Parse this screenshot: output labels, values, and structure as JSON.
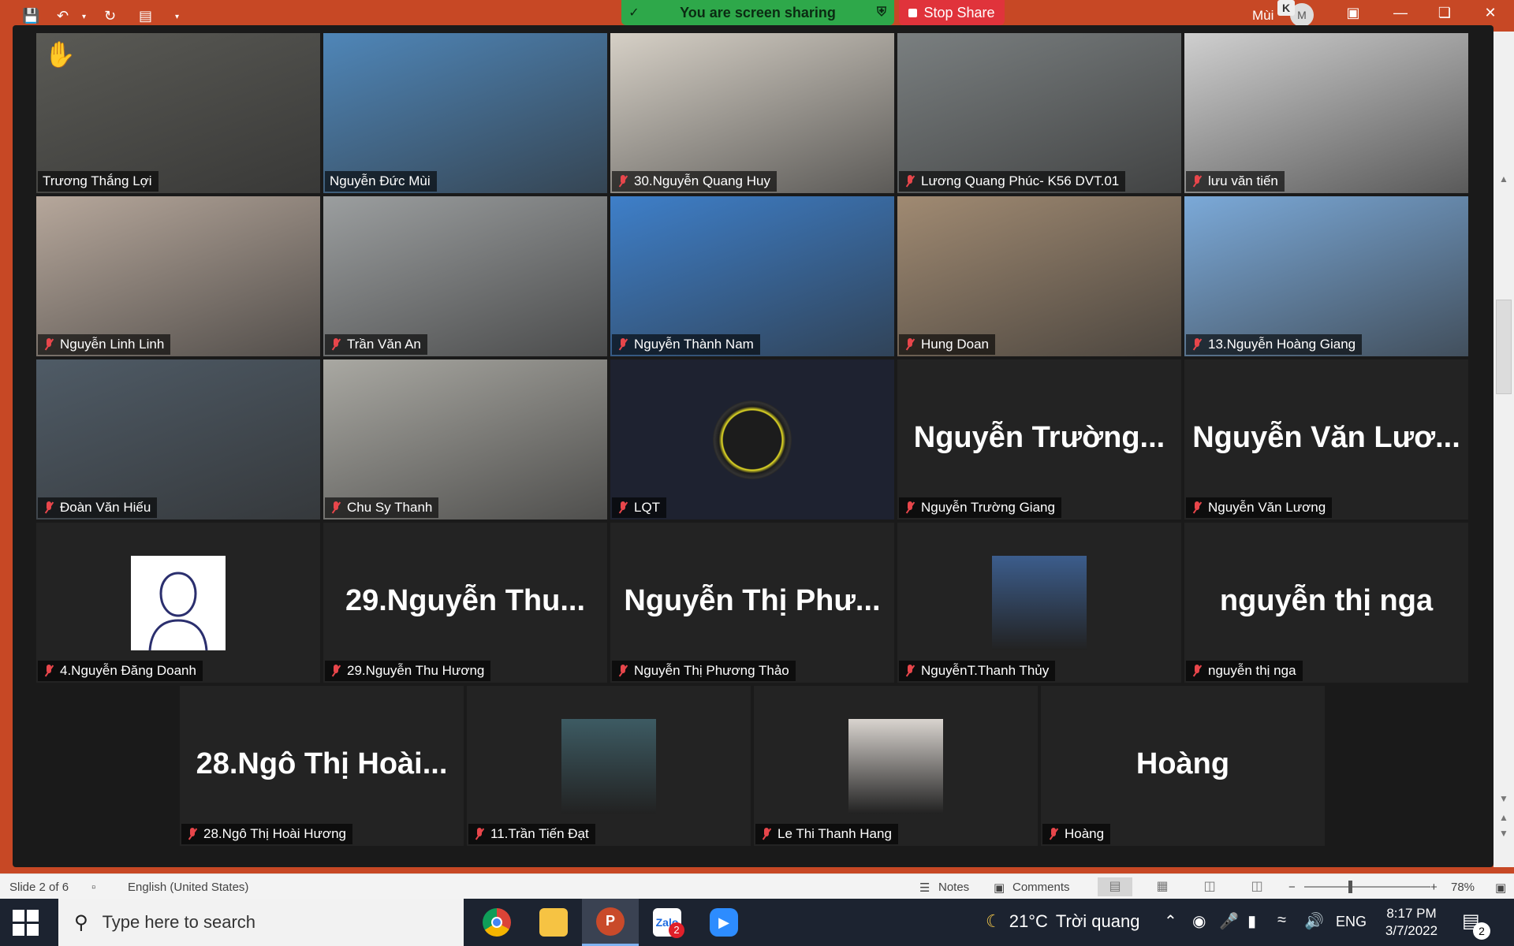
{
  "share": {
    "banner_text": "You are screen sharing",
    "stop_label": "Stop Share"
  },
  "ppt": {
    "user_name": "Mùi",
    "avatar_initial": "M",
    "avatar_badge": "K"
  },
  "participants": [
    {
      "name": "Trương Thắng Lợi",
      "kind": "video",
      "muted": false,
      "hand": true,
      "active": true,
      "bg": "#5a5a55"
    },
    {
      "name": "Nguyễn Đức Mùi",
      "kind": "video",
      "muted": false,
      "bg": "#4f86b8"
    },
    {
      "name": "30.Nguyễn Quang Huy",
      "kind": "video",
      "muted": true,
      "bg": "#d6d0c6"
    },
    {
      "name": "Lương Quang Phúc- K56 DVT.01",
      "kind": "video",
      "muted": true,
      "bg": "#7a7f80"
    },
    {
      "name": "lưu văn tiến",
      "kind": "video",
      "muted": true,
      "bg": "#cfcfcf"
    },
    {
      "name": "Nguyễn Linh Linh",
      "kind": "video",
      "muted": true,
      "bg": "#b6a79b"
    },
    {
      "name": "Trần Văn An",
      "kind": "video",
      "muted": true,
      "bg": "#9b9e9f"
    },
    {
      "name": "Nguyễn Thành Nam",
      "kind": "video",
      "muted": true,
      "bg": "#3e7fc9"
    },
    {
      "name": "Hung Doan",
      "kind": "video",
      "muted": true,
      "bg": "#a08a72"
    },
    {
      "name": "13.Nguyễn Hoàng Giang",
      "kind": "video",
      "muted": true,
      "bg": "#7ba9d8"
    },
    {
      "name": "Đoàn Văn Hiếu",
      "kind": "video",
      "muted": true,
      "bg": "#4f5b66"
    },
    {
      "name": "Chu Sy Thanh",
      "kind": "video",
      "muted": true,
      "bg": "#a9a8a2"
    },
    {
      "name": "LQT",
      "kind": "logo",
      "muted": true,
      "bg": "#1e2230"
    },
    {
      "name": "Nguyễn Trường Giang",
      "kind": "name",
      "display": "Nguyễn Trường...",
      "muted": true
    },
    {
      "name": "Nguyễn Văn Lương",
      "kind": "name",
      "display": "Nguyễn Văn Lươ...",
      "muted": true
    },
    {
      "name": "4.Nguyễn Đăng Doanh",
      "kind": "avatar",
      "avatar": "silhouette",
      "muted": true
    },
    {
      "name": "29.Nguyễn Thu Hương",
      "kind": "name",
      "display": "29.Nguyễn Thu...",
      "muted": true
    },
    {
      "name": "Nguyễn Thị Phương Thảo",
      "kind": "name",
      "display": "Nguyễn Thị Phư...",
      "muted": true
    },
    {
      "name": "NguyễnT.Thanh Thủy",
      "kind": "avatar",
      "avatar": "photo",
      "avatar_bg": "#3c5d8c",
      "muted": true
    },
    {
      "name": "nguyễn thị nga",
      "kind": "name",
      "display": "nguyễn thị nga",
      "muted": true
    },
    {
      "name": "28.Ngô Thị Hoài Hương",
      "kind": "name",
      "display": "28.Ngô Thị Hoài...",
      "muted": true
    },
    {
      "name": "11.Trần Tiến Đạt",
      "kind": "avatar",
      "avatar": "photo",
      "avatar_bg": "#3d5b63",
      "muted": true
    },
    {
      "name": "Le Thi Thanh Hang",
      "kind": "avatar",
      "avatar": "photo",
      "avatar_bg": "#d9d4cf",
      "muted": true
    },
    {
      "name": "Hoàng",
      "kind": "name",
      "display": "Hoàng",
      "muted": true
    }
  ],
  "statusbar": {
    "slide": "Slide 2 of 6",
    "language": "English (United States)",
    "notes": "Notes",
    "comments": "Comments",
    "zoom": "78%"
  },
  "taskbar": {
    "search_placeholder": "Type here to search",
    "temperature": "21°C",
    "weather": "Trời quang",
    "lang": "ENG",
    "time": "8:17 PM",
    "date": "3/7/2022",
    "notifications": "2",
    "zalo_badge": "2"
  }
}
